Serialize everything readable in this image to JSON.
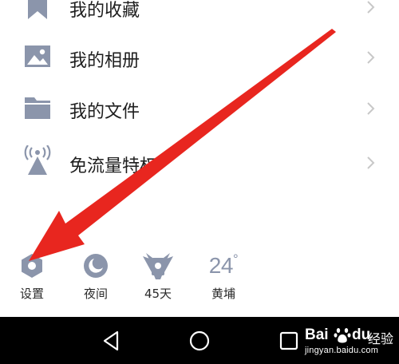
{
  "menu": {
    "items": [
      {
        "label": "我的收藏",
        "icon": "bookmark-icon"
      },
      {
        "label": "我的相册",
        "icon": "image-icon"
      },
      {
        "label": "我的文件",
        "icon": "folder-icon"
      },
      {
        "label": "免流量特权",
        "icon": "signal-tower-icon"
      }
    ]
  },
  "toolbar": {
    "settings_label": "设置",
    "night_label": "夜间",
    "days_label": "45天",
    "weather_temp": "24",
    "weather_unit": "°",
    "weather_location": "黄埔"
  },
  "navbar": {
    "buttons": [
      "back-icon",
      "home-icon",
      "recent-apps-icon"
    ]
  },
  "watermark": {
    "brand": "Bai",
    "brand2": "du",
    "jingyan": "经验",
    "url": "jingyan.baidu.com"
  },
  "colors": {
    "icon": "#8b95ab",
    "text": "#1e1e1e",
    "chevron": "#c8c8c8",
    "arrow": "#e8261f",
    "navbar": "#000000"
  }
}
